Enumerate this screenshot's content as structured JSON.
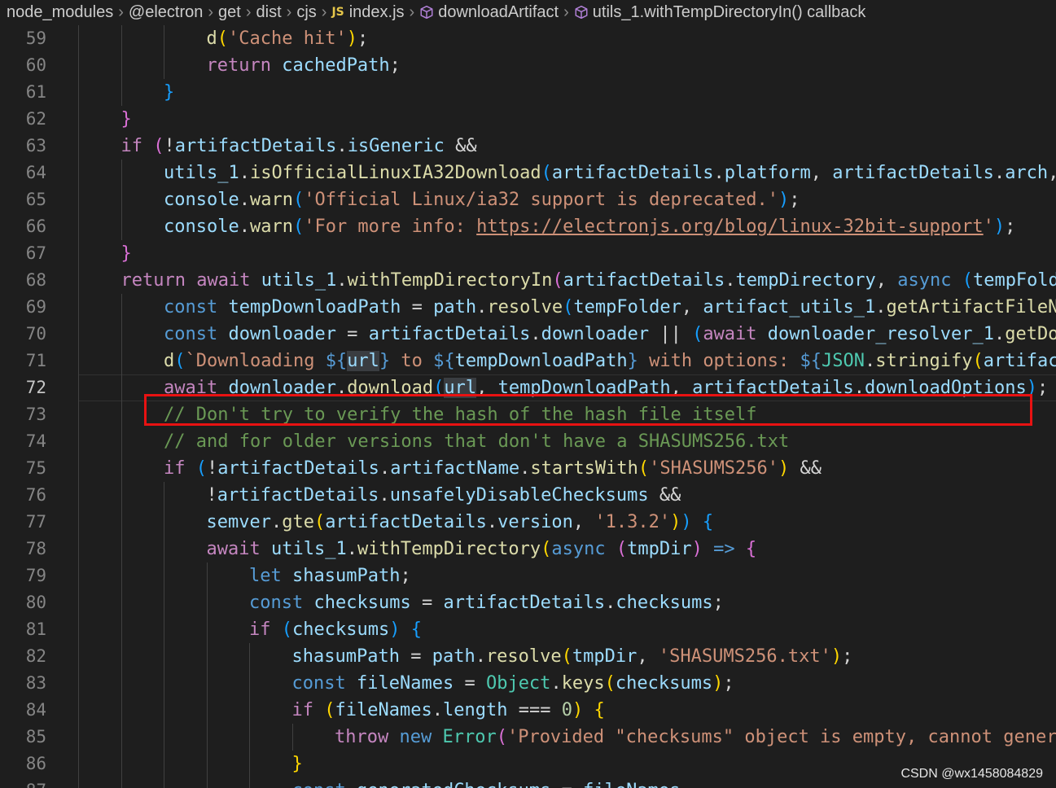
{
  "breadcrumb": {
    "items": [
      "node_modules",
      "@electron",
      "get",
      "dist",
      "cjs",
      "index.js",
      "downloadArtifact",
      "utils_1.withTempDirectoryIn() callback"
    ],
    "js_badge": "JS",
    "separator": "›"
  },
  "editor": {
    "active_line": 72,
    "lines": [
      {
        "n": "59",
        "indent": 3,
        "tokens": [
          [
            "fn",
            "d"
          ],
          [
            "b1",
            "("
          ],
          [
            "str",
            "'Cache hit'"
          ],
          [
            "b1",
            ")"
          ],
          [
            "op",
            ";"
          ]
        ]
      },
      {
        "n": "60",
        "indent": 3,
        "tokens": [
          [
            "ctl",
            "return "
          ],
          [
            "var",
            "cachedPath"
          ],
          [
            "op",
            ";"
          ]
        ]
      },
      {
        "n": "61",
        "indent": 2,
        "tokens": [
          [
            "b3",
            "}"
          ]
        ]
      },
      {
        "n": "62",
        "indent": 1,
        "tokens": [
          [
            "b2",
            "}"
          ]
        ]
      },
      {
        "n": "63",
        "indent": 1,
        "tokens": [
          [
            "ctl",
            "if "
          ],
          [
            "b2",
            "("
          ],
          [
            "op",
            "!"
          ],
          [
            "var",
            "artifactDetails"
          ],
          [
            "op",
            "."
          ],
          [
            "var",
            "isGeneric"
          ],
          [
            "op",
            " &&"
          ]
        ]
      },
      {
        "n": "64",
        "indent": 2,
        "tokens": [
          [
            "var",
            "utils_1"
          ],
          [
            "op",
            "."
          ],
          [
            "fn",
            "isOfficialLinuxIA32Download"
          ],
          [
            "b3",
            "("
          ],
          [
            "var",
            "artifactDetails"
          ],
          [
            "op",
            "."
          ],
          [
            "var",
            "platform"
          ],
          [
            "op",
            ", "
          ],
          [
            "var",
            "artifactDetails"
          ],
          [
            "op",
            "."
          ],
          [
            "var",
            "arch"
          ],
          [
            "op",
            ","
          ]
        ]
      },
      {
        "n": "65",
        "indent": 2,
        "tokens": [
          [
            "var",
            "console"
          ],
          [
            "op",
            "."
          ],
          [
            "fn",
            "warn"
          ],
          [
            "b3",
            "("
          ],
          [
            "str",
            "'Official Linux/ia32 support is deprecated.'"
          ],
          [
            "b3",
            ")"
          ],
          [
            "op",
            ";"
          ]
        ]
      },
      {
        "n": "66",
        "indent": 2,
        "tokens": [
          [
            "var",
            "console"
          ],
          [
            "op",
            "."
          ],
          [
            "fn",
            "warn"
          ],
          [
            "b3",
            "("
          ],
          [
            "str",
            "'For more info: "
          ],
          [
            "url",
            "https://electronjs.org/blog/linux-32bit-support"
          ],
          [
            "str",
            "'"
          ],
          [
            "b3",
            ")"
          ],
          [
            "op",
            ";"
          ]
        ]
      },
      {
        "n": "67",
        "indent": 1,
        "tokens": [
          [
            "b2",
            "}"
          ]
        ]
      },
      {
        "n": "68",
        "indent": 1,
        "tokens": [
          [
            "ctl",
            "return "
          ],
          [
            "ctl",
            "await "
          ],
          [
            "var",
            "utils_1"
          ],
          [
            "op",
            "."
          ],
          [
            "fn",
            "withTempDirectoryIn"
          ],
          [
            "b2",
            "("
          ],
          [
            "var",
            "artifactDetails"
          ],
          [
            "op",
            "."
          ],
          [
            "var",
            "tempDirectory"
          ],
          [
            "op",
            ", "
          ],
          [
            "key",
            "async "
          ],
          [
            "b3",
            "("
          ],
          [
            "var",
            "tempFolder"
          ]
        ]
      },
      {
        "n": "69",
        "indent": 2,
        "tokens": [
          [
            "key",
            "const "
          ],
          [
            "var",
            "tempDownloadPath"
          ],
          [
            "op",
            " = "
          ],
          [
            "var",
            "path"
          ],
          [
            "op",
            "."
          ],
          [
            "fn",
            "resolve"
          ],
          [
            "b3",
            "("
          ],
          [
            "var",
            "tempFolder"
          ],
          [
            "op",
            ", "
          ],
          [
            "var",
            "artifact_utils_1"
          ],
          [
            "op",
            "."
          ],
          [
            "fn",
            "getArtifactFileName"
          ]
        ]
      },
      {
        "n": "70",
        "indent": 2,
        "tokens": [
          [
            "key",
            "const "
          ],
          [
            "var",
            "downloader"
          ],
          [
            "op",
            " = "
          ],
          [
            "var",
            "artifactDetails"
          ],
          [
            "op",
            "."
          ],
          [
            "var",
            "downloader"
          ],
          [
            "op",
            " || "
          ],
          [
            "b3",
            "("
          ],
          [
            "ctl",
            "await "
          ],
          [
            "var",
            "downloader_resolver_1"
          ],
          [
            "op",
            "."
          ],
          [
            "fn",
            "getDownloader"
          ]
        ]
      },
      {
        "n": "71",
        "indent": 2,
        "tokens": [
          [
            "fn",
            "d"
          ],
          [
            "b3",
            "("
          ],
          [
            "str",
            "`Downloading "
          ],
          [
            "key",
            "${"
          ],
          [
            "hl",
            "url"
          ],
          [
            "key",
            "}"
          ],
          [
            "str",
            " to "
          ],
          [
            "key",
            "${"
          ],
          [
            "var",
            "tempDownloadPath"
          ],
          [
            "key",
            "}"
          ],
          [
            "str",
            " with options: "
          ],
          [
            "key",
            "${"
          ],
          [
            "cls",
            "JSON"
          ],
          [
            "op",
            "."
          ],
          [
            "fn",
            "stringify"
          ],
          [
            "b1",
            "("
          ],
          [
            "var",
            "artifactDetails"
          ]
        ]
      },
      {
        "n": "72",
        "indent": 2,
        "tokens": [
          [
            "ctl",
            "await "
          ],
          [
            "var",
            "downloader"
          ],
          [
            "op",
            "."
          ],
          [
            "fn",
            "download"
          ],
          [
            "b3",
            "("
          ],
          [
            "hl",
            "url"
          ],
          [
            "op",
            ", "
          ],
          [
            "var",
            "tempDownloadPath"
          ],
          [
            "op",
            ", "
          ],
          [
            "var",
            "artifactDetails"
          ],
          [
            "op",
            "."
          ],
          [
            "var",
            "downloadOptions"
          ],
          [
            "b3",
            ")"
          ],
          [
            "op",
            ";"
          ]
        ]
      },
      {
        "n": "73",
        "indent": 2,
        "tokens": [
          [
            "cmt",
            "// Don't try to verify the hash of the hash file itself"
          ]
        ]
      },
      {
        "n": "74",
        "indent": 2,
        "tokens": [
          [
            "cmt",
            "// and for older versions that don't have a SHASUMS256.txt"
          ]
        ]
      },
      {
        "n": "75",
        "indent": 2,
        "tokens": [
          [
            "ctl",
            "if "
          ],
          [
            "b3",
            "("
          ],
          [
            "op",
            "!"
          ],
          [
            "var",
            "artifactDetails"
          ],
          [
            "op",
            "."
          ],
          [
            "var",
            "artifactName"
          ],
          [
            "op",
            "."
          ],
          [
            "fn",
            "startsWith"
          ],
          [
            "b1",
            "("
          ],
          [
            "str",
            "'SHASUMS256'"
          ],
          [
            "b1",
            ")"
          ],
          [
            "op",
            " &&"
          ]
        ]
      },
      {
        "n": "76",
        "indent": 3,
        "tokens": [
          [
            "op",
            "!"
          ],
          [
            "var",
            "artifactDetails"
          ],
          [
            "op",
            "."
          ],
          [
            "var",
            "unsafelyDisableChecksums"
          ],
          [
            "op",
            " &&"
          ]
        ]
      },
      {
        "n": "77",
        "indent": 3,
        "tokens": [
          [
            "var",
            "semver"
          ],
          [
            "op",
            "."
          ],
          [
            "fn",
            "gte"
          ],
          [
            "b1",
            "("
          ],
          [
            "var",
            "artifactDetails"
          ],
          [
            "op",
            "."
          ],
          [
            "var",
            "version"
          ],
          [
            "op",
            ", "
          ],
          [
            "str",
            "'1.3.2'"
          ],
          [
            "b1",
            ")"
          ],
          [
            "b3",
            ")"
          ],
          [
            "op",
            " "
          ],
          [
            "b3",
            "{"
          ]
        ]
      },
      {
        "n": "78",
        "indent": 3,
        "tokens": [
          [
            "ctl",
            "await "
          ],
          [
            "var",
            "utils_1"
          ],
          [
            "op",
            "."
          ],
          [
            "fn",
            "withTempDirectory"
          ],
          [
            "b1",
            "("
          ],
          [
            "key",
            "async "
          ],
          [
            "b2",
            "("
          ],
          [
            "var",
            "tmpDir"
          ],
          [
            "b2",
            ")"
          ],
          [
            "key",
            " => "
          ],
          [
            "b2",
            "{"
          ]
        ]
      },
      {
        "n": "79",
        "indent": 4,
        "tokens": [
          [
            "key",
            "let "
          ],
          [
            "var",
            "shasumPath"
          ],
          [
            "op",
            ";"
          ]
        ]
      },
      {
        "n": "80",
        "indent": 4,
        "tokens": [
          [
            "key",
            "const "
          ],
          [
            "var",
            "checksums"
          ],
          [
            "op",
            " = "
          ],
          [
            "var",
            "artifactDetails"
          ],
          [
            "op",
            "."
          ],
          [
            "var",
            "checksums"
          ],
          [
            "op",
            ";"
          ]
        ]
      },
      {
        "n": "81",
        "indent": 4,
        "tokens": [
          [
            "ctl",
            "if "
          ],
          [
            "b3",
            "("
          ],
          [
            "var",
            "checksums"
          ],
          [
            "b3",
            ")"
          ],
          [
            "op",
            " "
          ],
          [
            "b3",
            "{"
          ]
        ]
      },
      {
        "n": "82",
        "indent": 5,
        "tokens": [
          [
            "var",
            "shasumPath"
          ],
          [
            "op",
            " = "
          ],
          [
            "var",
            "path"
          ],
          [
            "op",
            "."
          ],
          [
            "fn",
            "resolve"
          ],
          [
            "b1",
            "("
          ],
          [
            "var",
            "tmpDir"
          ],
          [
            "op",
            ", "
          ],
          [
            "str",
            "'SHASUMS256.txt'"
          ],
          [
            "b1",
            ")"
          ],
          [
            "op",
            ";"
          ]
        ]
      },
      {
        "n": "83",
        "indent": 5,
        "tokens": [
          [
            "key",
            "const "
          ],
          [
            "var",
            "fileNames"
          ],
          [
            "op",
            " = "
          ],
          [
            "cls",
            "Object"
          ],
          [
            "op",
            "."
          ],
          [
            "fn",
            "keys"
          ],
          [
            "b1",
            "("
          ],
          [
            "var",
            "checksums"
          ],
          [
            "b1",
            ")"
          ],
          [
            "op",
            ";"
          ]
        ]
      },
      {
        "n": "84",
        "indent": 5,
        "tokens": [
          [
            "ctl",
            "if "
          ],
          [
            "b1",
            "("
          ],
          [
            "var",
            "fileNames"
          ],
          [
            "op",
            "."
          ],
          [
            "var",
            "length"
          ],
          [
            "op",
            " === "
          ],
          [
            "num",
            "0"
          ],
          [
            "b1",
            ")"
          ],
          [
            "op",
            " "
          ],
          [
            "b1",
            "{"
          ]
        ]
      },
      {
        "n": "85",
        "indent": 6,
        "tokens": [
          [
            "ctl",
            "throw "
          ],
          [
            "key",
            "new "
          ],
          [
            "cls",
            "Error"
          ],
          [
            "b2",
            "("
          ],
          [
            "str",
            "'Provided \"checksums\" object is empty, cannot generate"
          ]
        ]
      },
      {
        "n": "86",
        "indent": 5,
        "tokens": [
          [
            "b1",
            "}"
          ]
        ]
      },
      {
        "n": "87",
        "indent": 5,
        "tokens": [
          [
            "key",
            "const "
          ],
          [
            "var",
            "generatedChecksums"
          ],
          [
            "op",
            " = "
          ],
          [
            "var",
            "fileNames"
          ]
        ]
      }
    ]
  },
  "watermark": "CSDN @wx1458084829"
}
